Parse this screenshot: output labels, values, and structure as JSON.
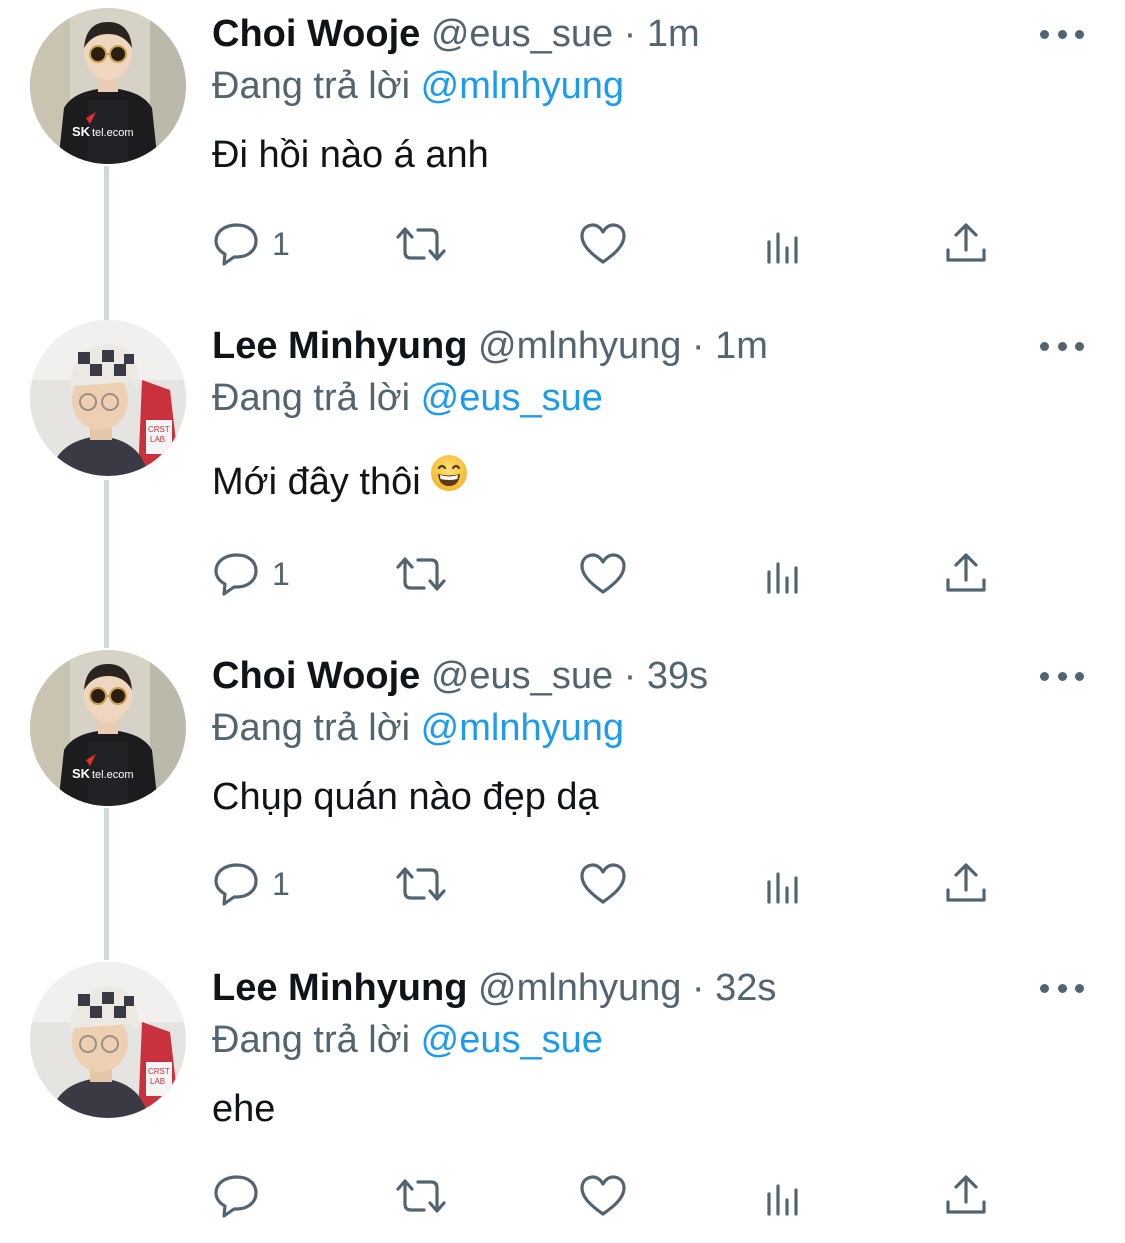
{
  "tweets": [
    {
      "name": "Choi Wooje",
      "handle": "@eus_sue",
      "separator": "·",
      "time": "1m",
      "reply_prefix": "Đang trả lời",
      "reply_to": "@mlnhyung",
      "text": "Đi hồi nào á anh",
      "reply_count": "1",
      "avatar_icon": "avatar-choi-wooje"
    },
    {
      "name": "Lee Minhyung",
      "handle": "@mlnhyung",
      "separator": "·",
      "time": "1m",
      "reply_prefix": "Đang trả lời",
      "reply_to": "@eus_sue",
      "text": "Mới đây thôi",
      "emoji": "grinning-face-with-smiling-eyes",
      "reply_count": "1",
      "avatar_icon": "avatar-lee-minhyung"
    },
    {
      "name": "Choi Wooje",
      "handle": "@eus_sue",
      "separator": "·",
      "time": "39s",
      "reply_prefix": "Đang trả lời",
      "reply_to": "@mlnhyung",
      "text": "Chụp quán nào đẹp dạ",
      "reply_count": "1",
      "avatar_icon": "avatar-choi-wooje"
    },
    {
      "name": "Lee Minhyung",
      "handle": "@mlnhyung",
      "separator": "·",
      "time": "32s",
      "reply_prefix": "Đang trả lời",
      "reply_to": "@eus_sue",
      "text": "ehe",
      "reply_count": "",
      "avatar_icon": "avatar-lee-minhyung"
    }
  ],
  "icons": {
    "reply": "reply-bubble-icon",
    "retweet": "retweet-icon",
    "like": "heart-icon",
    "views": "analytics-icon",
    "share": "share-icon",
    "more": "more-dots-icon"
  },
  "colors": {
    "link": "#1d9bf0",
    "secondary_text": "#536471",
    "primary_text": "#0f1419",
    "thread_line": "#cfd9de"
  }
}
